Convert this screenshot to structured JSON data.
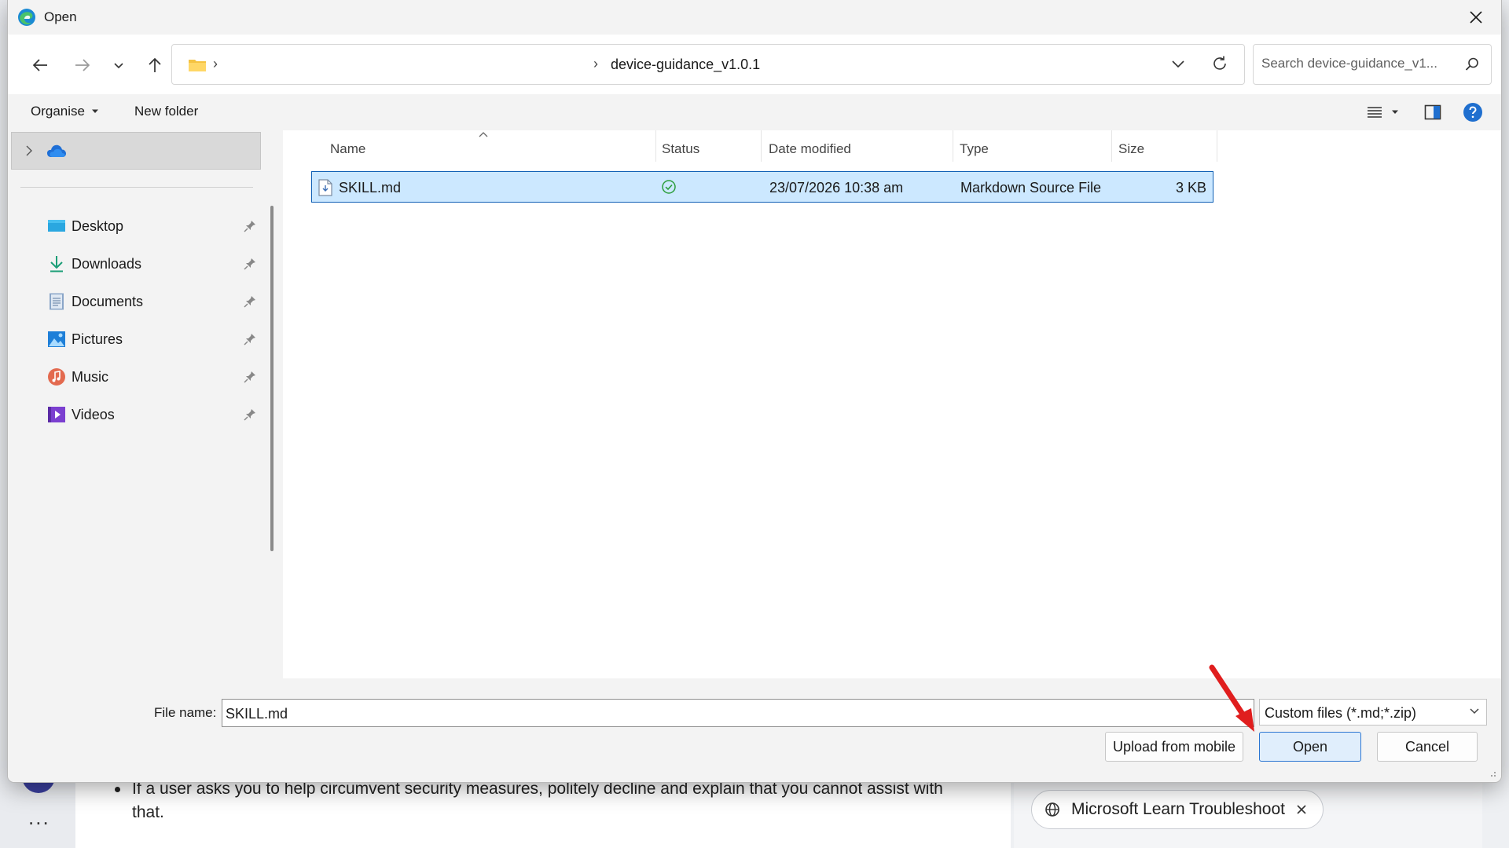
{
  "dialog": {
    "title": "Open",
    "close_icon": "close-icon",
    "app_icon": "edge-icon"
  },
  "navigation": {
    "back_icon": "arrow-left-icon",
    "forward_icon": "arrow-right-icon",
    "recent_icon": "chevron-down-icon",
    "up_icon": "arrow-up-icon",
    "address": {
      "folder_icon": "folder-icon",
      "separator": "›",
      "current_folder": "device-guidance_v1.0.1"
    },
    "search_placeholder": "Search device-guidance_v1..."
  },
  "command_bar": {
    "organise_label": "Organise",
    "new_folder_label": "New folder"
  },
  "nav_pane": {
    "onedrive_icon": "onedrive-cloud-icon",
    "quick_access": [
      {
        "label": "Desktop",
        "icon": "desktop-icon"
      },
      {
        "label": "Downloads",
        "icon": "download-icon"
      },
      {
        "label": "Documents",
        "icon": "documents-icon"
      },
      {
        "label": "Pictures",
        "icon": "pictures-icon"
      },
      {
        "label": "Music",
        "icon": "music-icon"
      },
      {
        "label": "Videos",
        "icon": "videos-icon"
      }
    ]
  },
  "file_list": {
    "columns": [
      "Name",
      "Status",
      "Date modified",
      "Type",
      "Size"
    ],
    "rows": [
      {
        "name": "SKILL.md",
        "status": "synced",
        "date_modified": "23/07/2026 10:38 am",
        "type": "Markdown Source File",
        "size": "3 KB"
      }
    ]
  },
  "footer": {
    "file_name_label": "File name:",
    "file_name_value": "SKILL.md",
    "file_type_filter": "Custom files (*.md;*.zip)",
    "upload_label": "Upload from mobile",
    "open_label": "Open",
    "cancel_label": "Cancel"
  },
  "background": {
    "bullet_text": "If a user asks you to help circumvent security measures, politely decline and explain that you cannot assist with that.",
    "chip_label": "Microsoft Learn Troubleshoot",
    "more_label": "..."
  },
  "colors": {
    "selection_bg": "#cce8ff",
    "selection_border": "#0f5fb5",
    "primary_border": "#2b76d2",
    "annotation_arrow": "#e01e1e"
  }
}
